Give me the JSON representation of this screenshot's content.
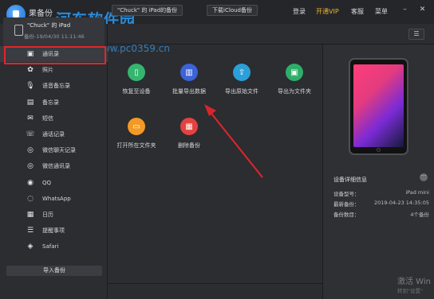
{
  "app": {
    "name": "果备份"
  },
  "watermark": {
    "title": "河东软件园",
    "url": "www.pc0359.cn"
  },
  "top_menu": {
    "login": "登录",
    "vip": "开通VIP",
    "service": "客服",
    "menu": "菜单"
  },
  "device": {
    "name": "\"Chuck\" 的 iPad",
    "backup_time": "备份-19/04/30 11:11:46"
  },
  "sidebar": {
    "items": [
      {
        "label": "通讯录",
        "icon": "contacts-icon",
        "glyph": "▣"
      },
      {
        "label": "照片",
        "icon": "photos-icon",
        "glyph": "✿"
      },
      {
        "label": "语音备忘录",
        "icon": "microphone-icon",
        "glyph": "🎙"
      },
      {
        "label": "备忘录",
        "icon": "notes-icon",
        "glyph": "▤"
      },
      {
        "label": "短信",
        "icon": "messages-icon",
        "glyph": "✉"
      },
      {
        "label": "通话记录",
        "icon": "call-log-icon",
        "glyph": "☏"
      },
      {
        "label": "微信聊天记录",
        "icon": "wechat-chat-icon",
        "glyph": "◎"
      },
      {
        "label": "微信通讯录",
        "icon": "wechat-contacts-icon",
        "glyph": "◎"
      },
      {
        "label": "QQ",
        "icon": "qq-icon",
        "glyph": "◉"
      },
      {
        "label": "WhatsApp",
        "icon": "whatsapp-icon",
        "glyph": "◌"
      },
      {
        "label": "日历",
        "icon": "calendar-icon",
        "glyph": "▦"
      },
      {
        "label": "提醒事项",
        "icon": "reminders-icon",
        "glyph": "☰"
      },
      {
        "label": "Safari",
        "icon": "safari-icon",
        "glyph": "◈"
      }
    ],
    "import_label": "导入备份"
  },
  "tabs": {
    "backup": "\"Chuck\" 的 iPad的备份",
    "icloud": "下载iCloud备份"
  },
  "actions": [
    {
      "label": "恢复至设备",
      "icon": "restore-device-icon",
      "glyph": "▯",
      "color": "#35b56f"
    },
    {
      "label": "批量导出数据",
      "icon": "batch-export-icon",
      "glyph": "▥",
      "color": "#3d63d9"
    },
    {
      "label": "导出原始文件",
      "icon": "export-raw-icon",
      "glyph": "⇪",
      "color": "#2b9fd8"
    },
    {
      "label": "导出为文件夹",
      "icon": "export-folder-icon",
      "glyph": "▣",
      "color": "#2fae6a"
    },
    {
      "label": "打开所在文件夹",
      "icon": "open-folder-icon",
      "glyph": "▭",
      "color": "#f39a26"
    },
    {
      "label": "删除备份",
      "icon": "delete-backup-icon",
      "glyph": "▦",
      "color": "#e2433f"
    }
  ],
  "details": {
    "title": "设备详细信息",
    "rows": [
      {
        "label": "设备型号：",
        "value": "iPad mini"
      },
      {
        "label": "最新备份：",
        "value": "2019-04-23 14:35:05"
      },
      {
        "label": "备份数目：",
        "value": "4个备份"
      }
    ]
  },
  "system": {
    "activate": "激活 Win",
    "activate_sub": "转到\"设置\""
  },
  "colors": {
    "highlight": "#e0262a",
    "arrow": "#d7262b",
    "vip": "#f0b429"
  }
}
